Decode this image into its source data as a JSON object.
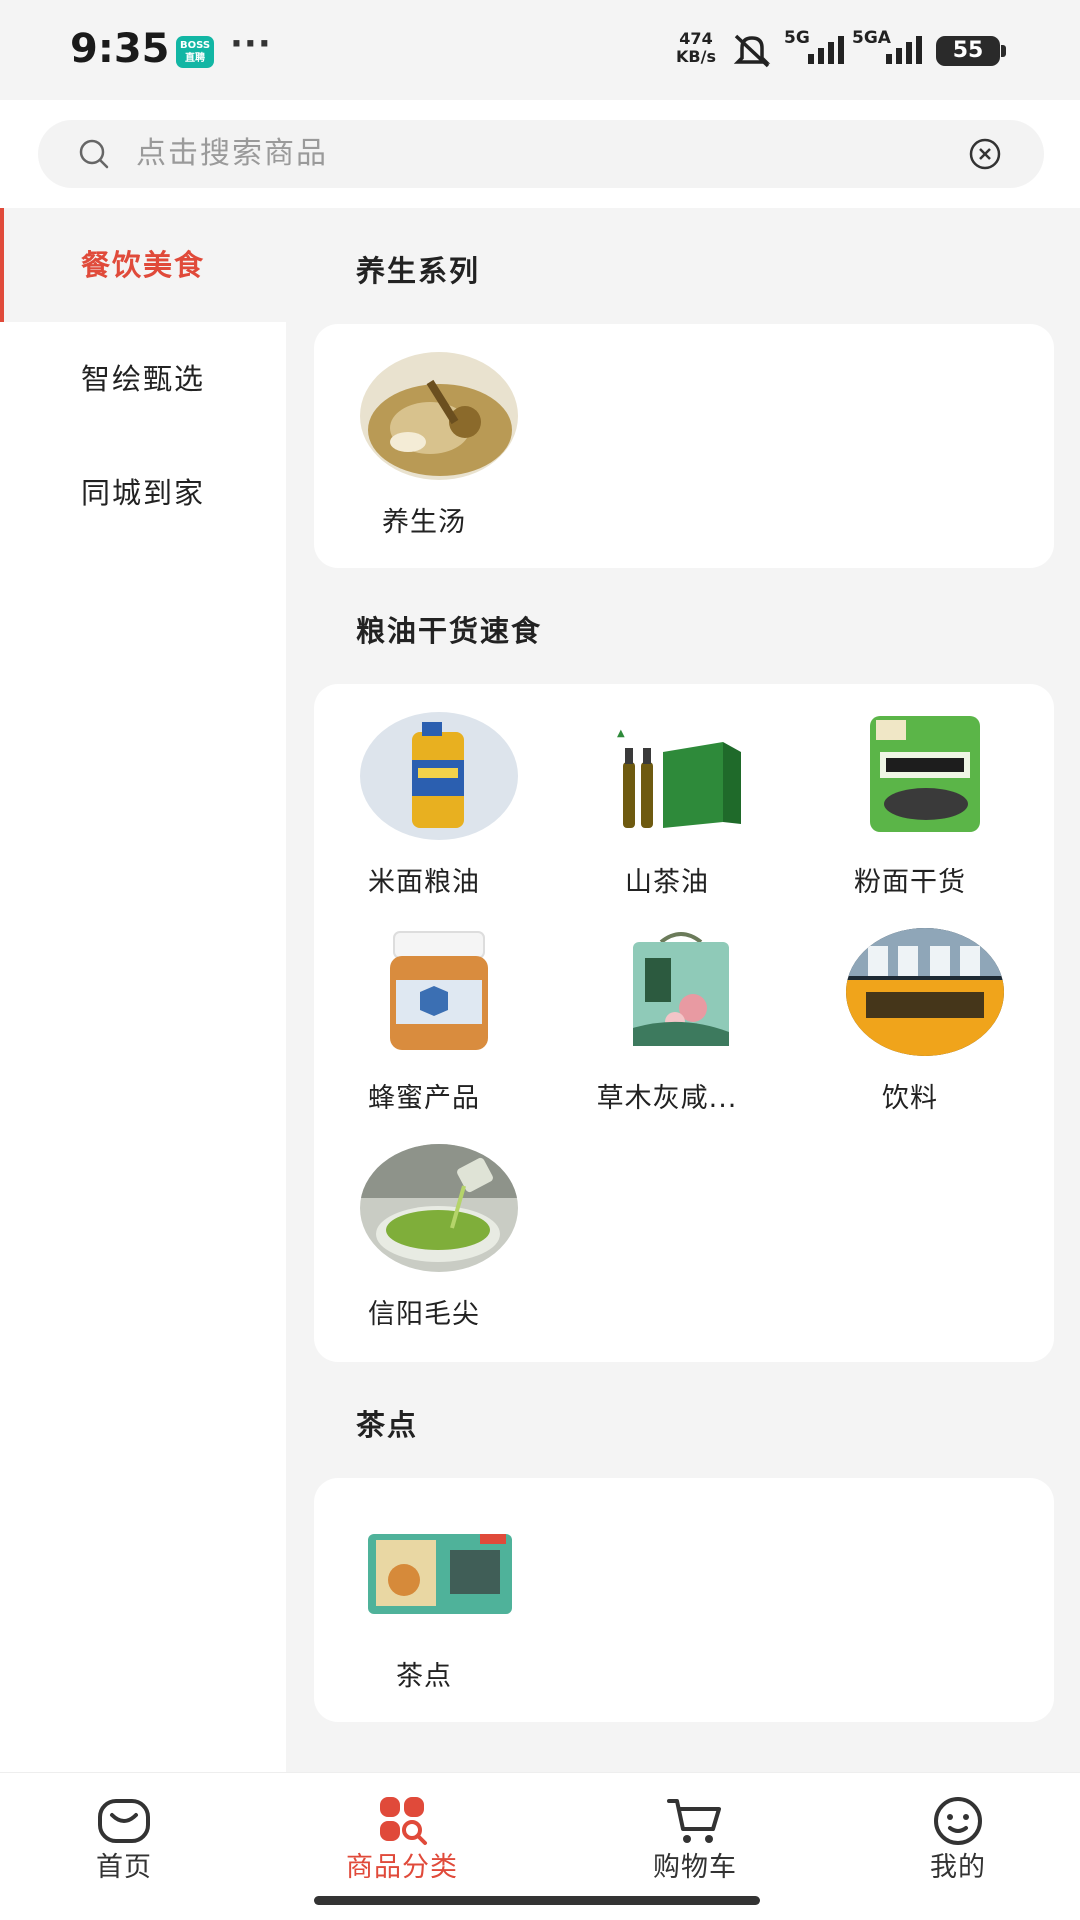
{
  "status_bar": {
    "time": "9:35",
    "app_badge": "BOSS直聘",
    "more": "···",
    "speed_value": "474",
    "speed_unit": "KB/s",
    "net1": "5G",
    "net2": "5GA",
    "battery": "55"
  },
  "search": {
    "placeholder": "点击搜索商品"
  },
  "sidebar": {
    "items": [
      {
        "label": "餐饮美食"
      },
      {
        "label": "智绘甄选"
      },
      {
        "label": "同城到家"
      }
    ]
  },
  "sections": [
    {
      "title": "养生系列",
      "items": [
        {
          "label": "养生汤"
        }
      ]
    },
    {
      "title": "粮油干货速食",
      "items": [
        {
          "label": "米面粮油"
        },
        {
          "label": "山茶油"
        },
        {
          "label": "粉面干货"
        },
        {
          "label": "蜂蜜产品"
        },
        {
          "label": "草木灰咸..."
        },
        {
          "label": "饮料"
        },
        {
          "label": "信阳毛尖"
        }
      ]
    },
    {
      "title": "茶点",
      "items": [
        {
          "label": "茶点"
        }
      ]
    }
  ],
  "nav": {
    "items": [
      {
        "label": "首页"
      },
      {
        "label": "商品分类"
      },
      {
        "label": "购物车"
      },
      {
        "label": "我的"
      }
    ]
  },
  "colors": {
    "accent": "#e04a3a",
    "background": "#f4f4f4"
  }
}
